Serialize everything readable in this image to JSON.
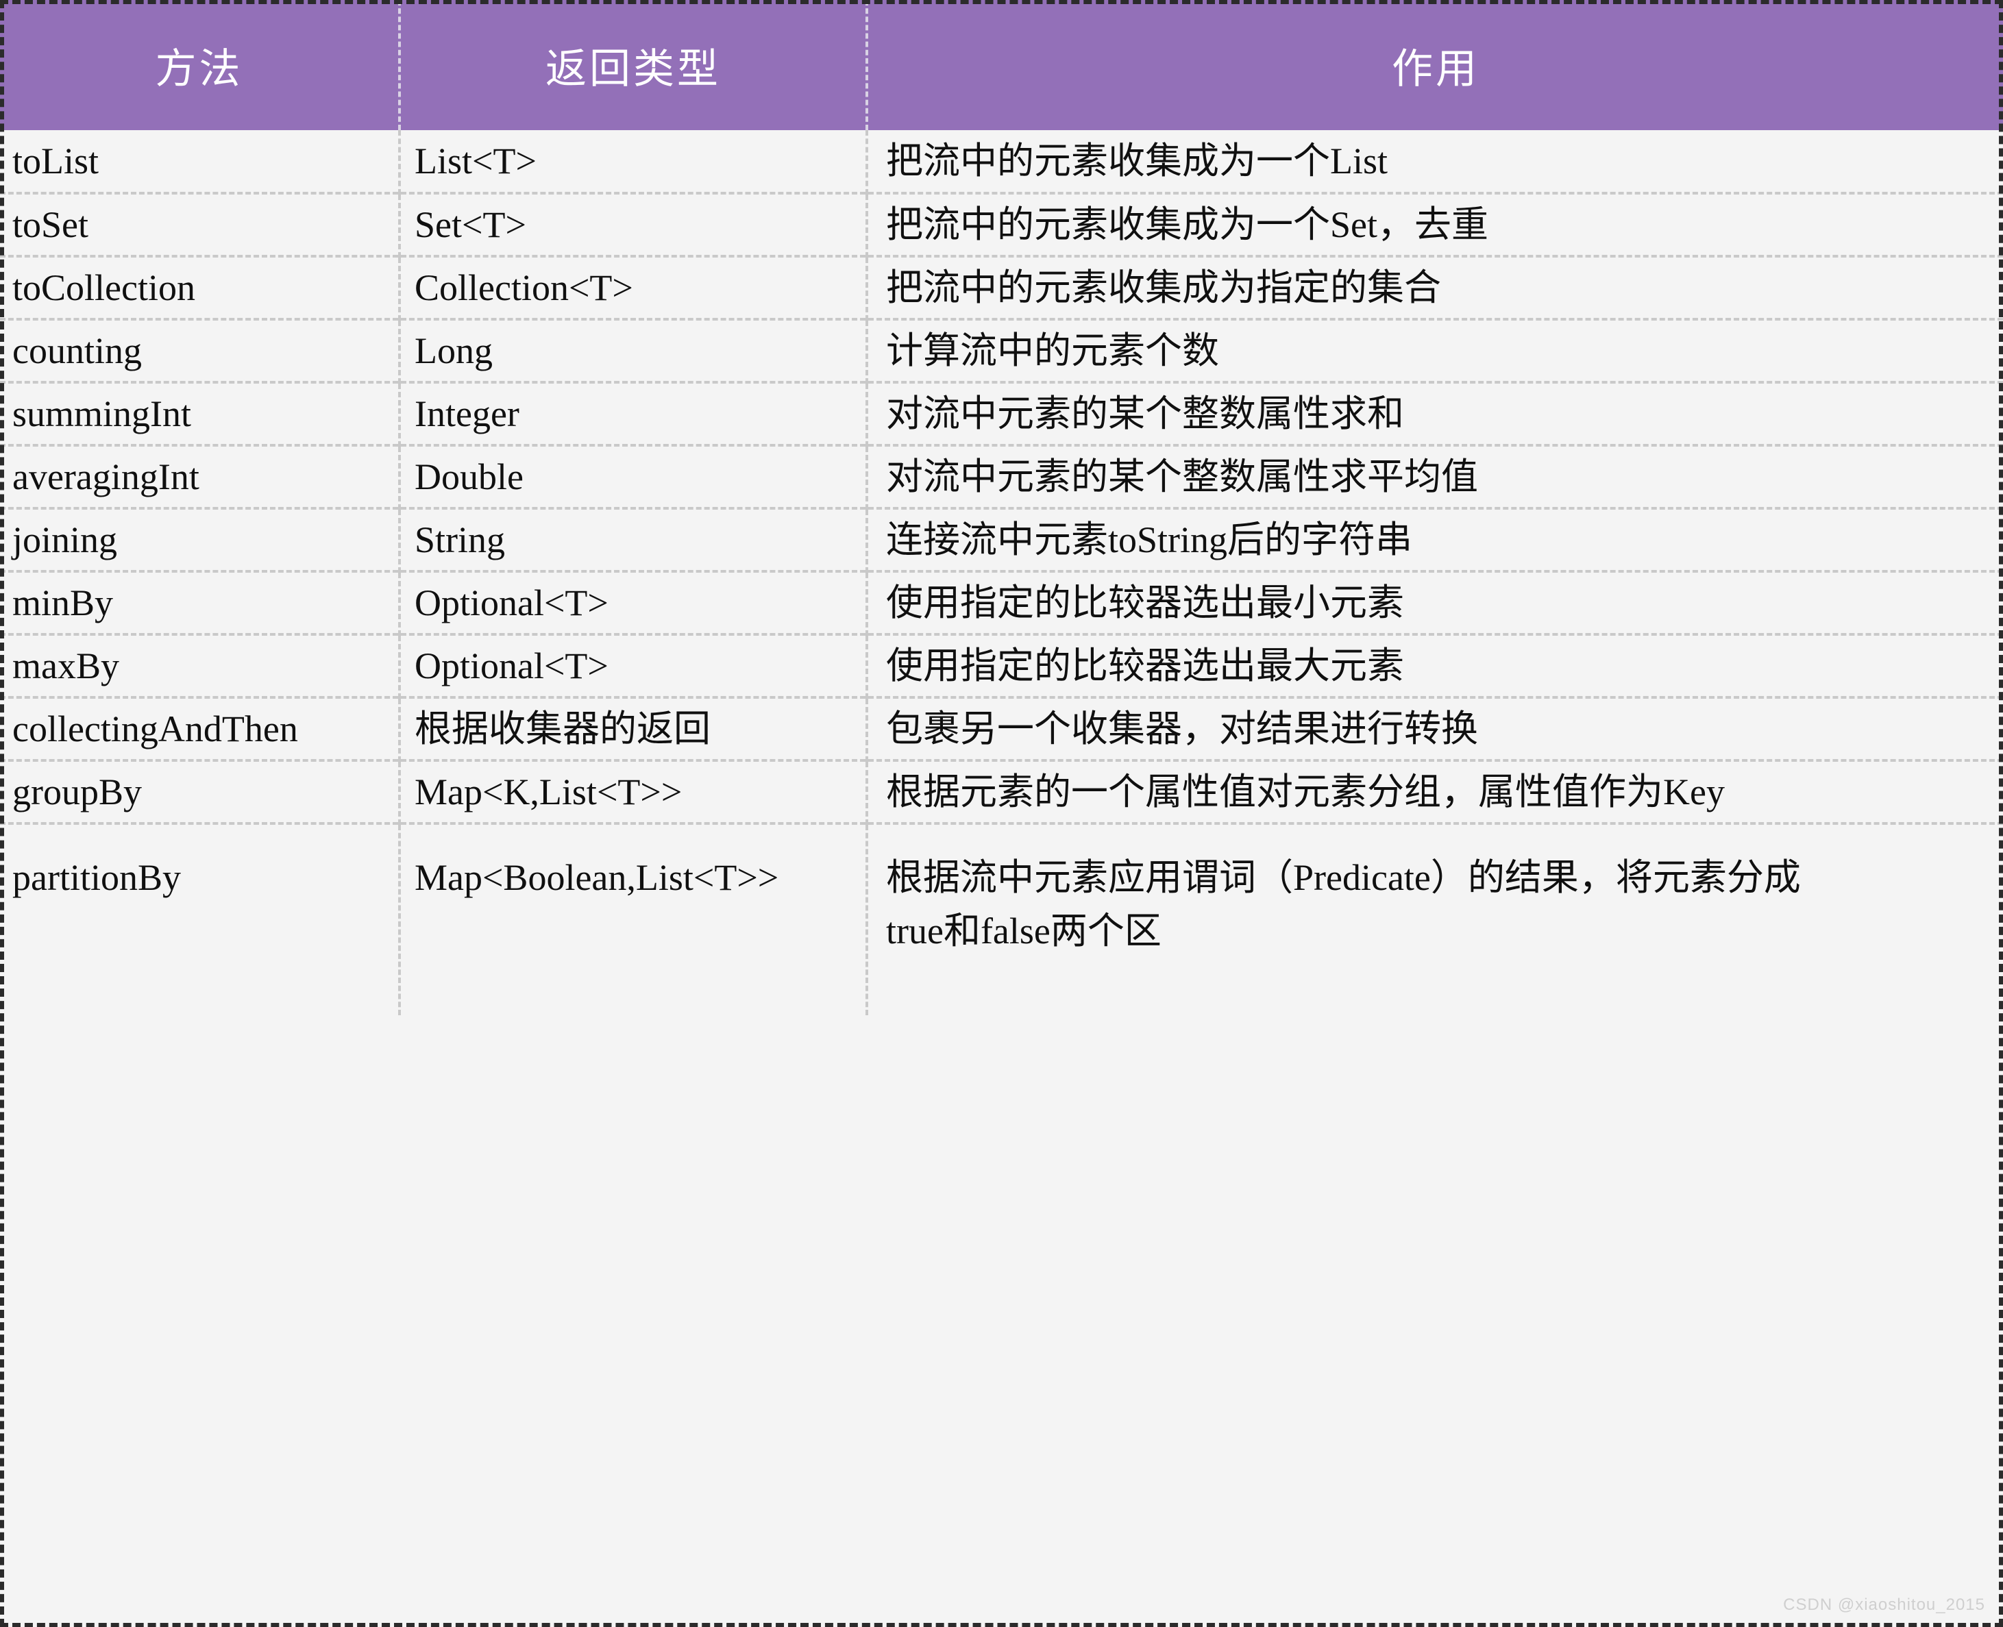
{
  "table": {
    "accent_color": "#9370B8",
    "header_text_color": "#FFFFFF",
    "background_color": "#F4F4F4",
    "grid_color": "#C9C9C9",
    "outer_border_color": "#2B2B2B",
    "columns": [
      {
        "key": "method",
        "label": "方法"
      },
      {
        "key": "type",
        "label": "返回类型"
      },
      {
        "key": "desc",
        "label": "作用"
      }
    ],
    "rows": [
      {
        "method": "toList",
        "type": "List<T>",
        "desc": "把流中的元素收集成为一个List"
      },
      {
        "method": "toSet",
        "type": "Set<T>",
        "desc": "把流中的元素收集成为一个Set，去重"
      },
      {
        "method": "toCollection",
        "type": "Collection<T>",
        "desc": "把流中的元素收集成为指定的集合"
      },
      {
        "method": "counting",
        "type": "Long",
        "desc": "计算流中的元素个数"
      },
      {
        "method": "summingInt",
        "type": "Integer",
        "desc": "对流中元素的某个整数属性求和"
      },
      {
        "method": "averagingInt",
        "type": "Double",
        "desc": "对流中元素的某个整数属性求平均值"
      },
      {
        "method": "joining",
        "type": "String",
        "desc": "连接流中元素toString后的字符串"
      },
      {
        "method": "minBy",
        "type": "Optional<T>",
        "desc": "使用指定的比较器选出最小元素"
      },
      {
        "method": "maxBy",
        "type": "Optional<T>",
        "desc": "使用指定的比较器选出最大元素"
      },
      {
        "method": "collectingAndThen",
        "type": "根据收集器的返回",
        "desc": "包裹另一个收集器，对结果进行转换"
      },
      {
        "method": "groupBy",
        "type": "Map<K,List<T>>",
        "desc": "根据元素的一个属性值对元素分组，属性值作为Key"
      },
      {
        "method": "partitionBy",
        "type": "Map<Boolean,List<T>>",
        "desc": "根据流中元素应用谓词（Predicate）的结果，将元素分成\ntrue和false两个区",
        "tall": true
      }
    ]
  },
  "watermark": {
    "text": "CSDN @xiaoshitou_2015"
  }
}
